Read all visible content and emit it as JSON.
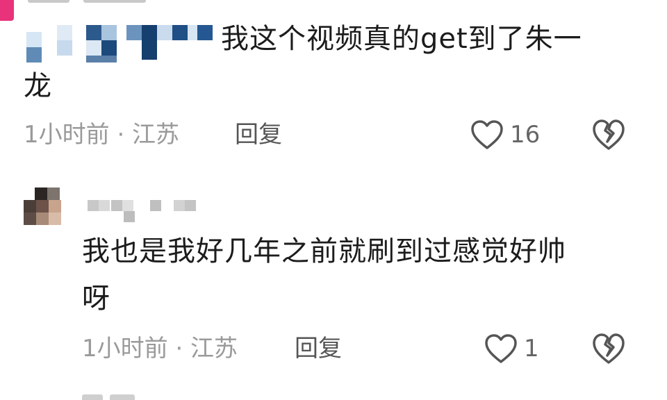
{
  "comments": [
    {
      "text_lines": [
        "我这个视频真的get到了朱一",
        "龙"
      ],
      "time_loc": "1小时前 · 江苏",
      "reply_label": "回复",
      "like_count": "16",
      "like_icon": "heart-outline-icon",
      "dislike_icon": "broken-heart-icon"
    },
    {
      "text_lines": [
        "我也是我好几年之前就刷到过感觉好帅",
        "呀"
      ],
      "time_loc": "1小时前 · 江苏",
      "reply_label": "回复",
      "like_count": "1",
      "like_icon": "heart-outline-icon",
      "dislike_icon": "broken-heart-icon"
    }
  ],
  "colors": {
    "text": "#1c1c1c",
    "meta": "#9a9a9a",
    "reply": "#555555",
    "icon": "#555555",
    "accent_pink": "#e8337a"
  }
}
